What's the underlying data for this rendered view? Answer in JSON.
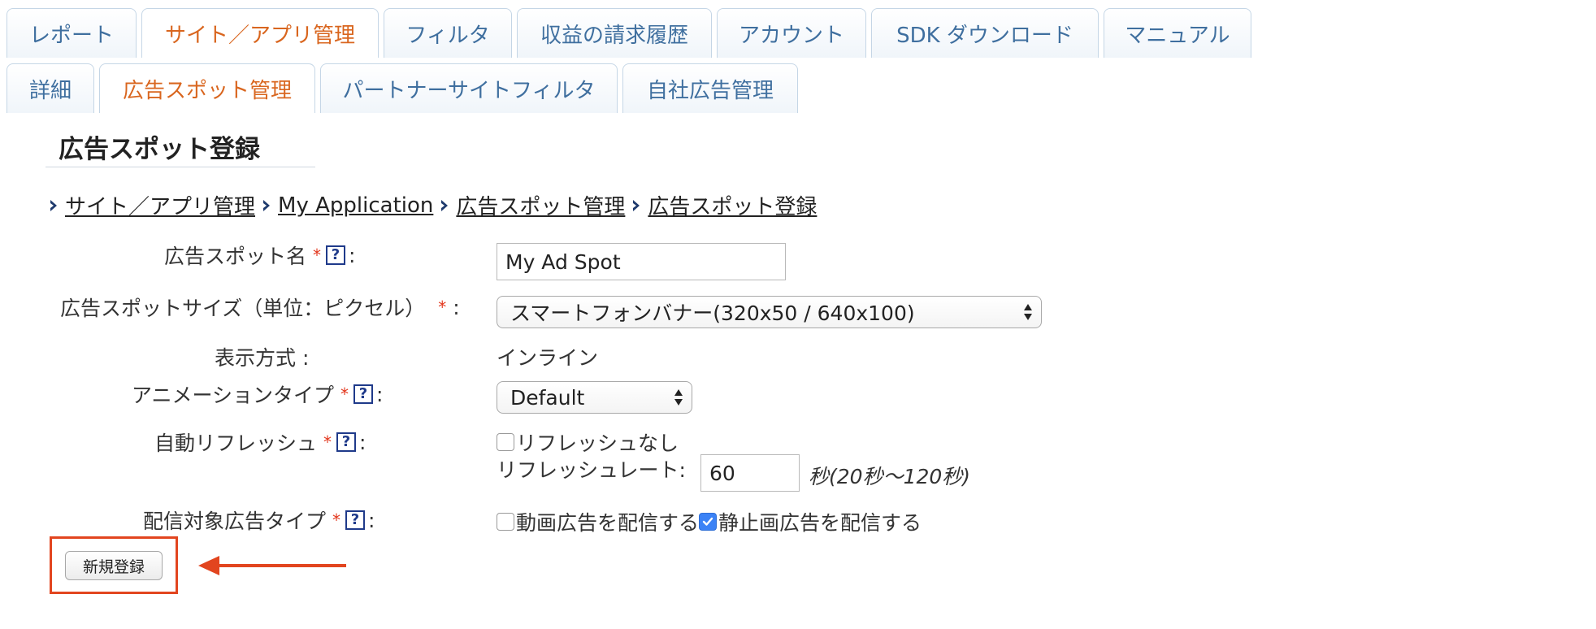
{
  "tabs_row1": [
    {
      "label": "レポート",
      "active": false
    },
    {
      "label": "サイト／アプリ管理",
      "active": true
    },
    {
      "label": "フィルタ",
      "active": false
    },
    {
      "label": "収益の請求履歴",
      "active": false
    },
    {
      "label": "アカウント",
      "active": false
    },
    {
      "label": "SDK ダウンロード",
      "active": false
    },
    {
      "label": "マニュアル",
      "active": false
    }
  ],
  "tabs_row2": [
    {
      "label": "詳細",
      "active": false
    },
    {
      "label": "広告スポット管理",
      "active": true
    },
    {
      "label": "パートナーサイトフィルタ",
      "active": false
    },
    {
      "label": "自社広告管理",
      "active": false
    }
  ],
  "page_title": "広告スポット登録",
  "breadcrumb": [
    "サイト／アプリ管理",
    "My Application",
    "広告スポット管理",
    "広告スポット登録"
  ],
  "form": {
    "spot_name": {
      "label": "広告スポット名",
      "value": "My Ad Spot"
    },
    "spot_size": {
      "label": "広告スポットサイズ（単位：ピクセル）",
      "selected": "スマートフォンバナー(320x50 / 640x100)"
    },
    "display_method": {
      "label": "表示方式 :",
      "value": "インライン"
    },
    "animation_type": {
      "label": "アニメーションタイプ",
      "selected": "Default"
    },
    "auto_refresh": {
      "label": "自動リフレッシュ",
      "no_refresh_label": "リフレッシュなし",
      "no_refresh_checked": false,
      "rate_label": "リフレッシュレート:",
      "rate_value": "60",
      "rate_hint": "秒(20秒〜120秒)"
    },
    "ad_type": {
      "label": "配信対象広告タイプ",
      "video_label": "動画広告を配信する",
      "video_checked": false,
      "static_label": "静止画広告を配信する",
      "static_checked": true
    }
  },
  "required_mark": "*",
  "help_mark": "?",
  "colon": ":",
  "submit_label": "新規登録",
  "colors": {
    "tab_text": "#3f6f9f",
    "tab_active": "#d9661f",
    "required": "#e2351b",
    "annotation": "#e2451f",
    "checkbox_checked": "#3b82f6"
  }
}
